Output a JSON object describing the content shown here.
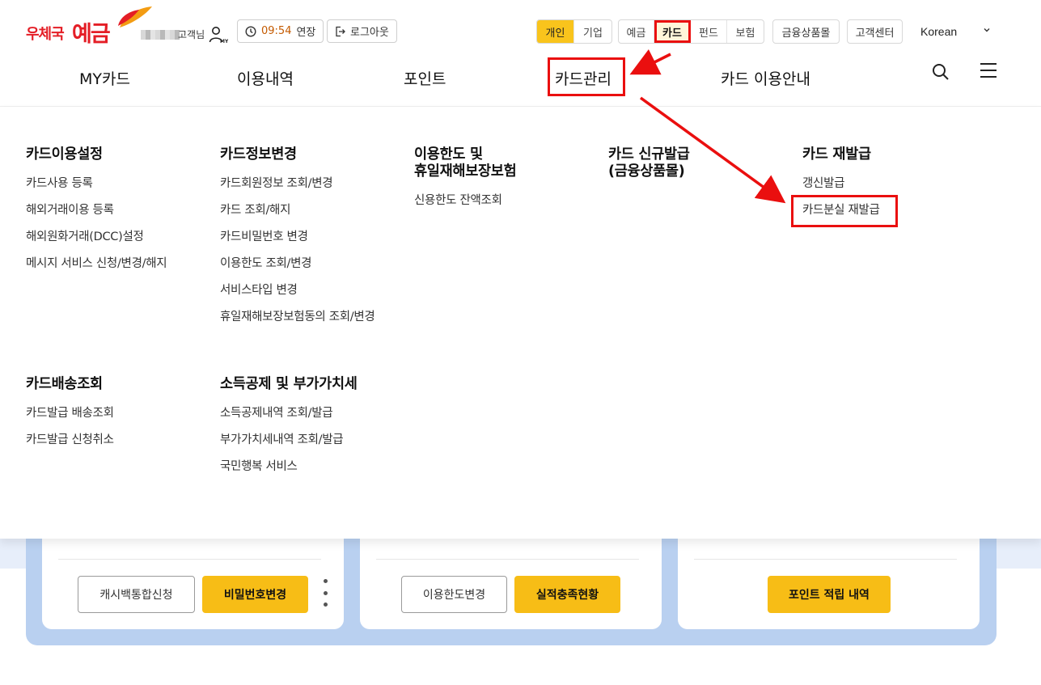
{
  "logo": {
    "brand": "우체국",
    "service": "예금"
  },
  "user": {
    "suffix": "고객님",
    "my_label": "MY"
  },
  "session": {
    "time": "09:54",
    "extend_label": "연장",
    "logout_label": "로그아웃"
  },
  "customer_type": {
    "options": [
      "개인",
      "기업"
    ],
    "active": "개인"
  },
  "service_tabs": {
    "options": [
      "예금",
      "카드",
      "펀드",
      "보험"
    ],
    "active": "카드"
  },
  "header_links": {
    "mall": "금융상품몰",
    "center": "고객센터"
  },
  "language": {
    "selected": "Korean"
  },
  "gnb": {
    "items": [
      "MY카드",
      "이용내역",
      "포인트",
      "카드관리",
      "카드 이용안내"
    ],
    "active": "카드관리"
  },
  "mega_menu": {
    "sections": [
      {
        "title": "카드이용설정",
        "items": [
          "카드사용 등록",
          "해외거래이용 등록",
          "해외원화거래(DCC)설정",
          "메시지 서비스 신청/변경/해지"
        ]
      },
      {
        "title": "카드정보변경",
        "items": [
          "카드회원정보 조회/변경",
          "카드 조회/해지",
          "카드비밀번호 변경",
          "이용한도 조회/변경",
          "서비스타입 변경",
          "휴일재해보장보험동의 조회/변경"
        ]
      },
      {
        "title_line1": "이용한도 및",
        "title_line2": "휴일재해보장보험",
        "items": [
          "신용한도 잔액조회"
        ]
      },
      {
        "title_line1": "카드 신규발급",
        "title_line2": "(금융상품몰)",
        "items": []
      },
      {
        "title": "카드 재발급",
        "items": [
          "갱신발급",
          "카드분실 재발급"
        ]
      },
      {
        "title": "카드배송조회",
        "items": [
          "카드발급 배송조회",
          "카드발급 신청취소"
        ]
      },
      {
        "title": "소득공제 및 부가가치세",
        "items": [
          "소득공제내역 조회/발급",
          "부가가치세내역 조회/발급",
          "국민행복 서비스"
        ]
      }
    ]
  },
  "background_cards": [
    {
      "buttons": [
        "캐시백통합신청",
        "비밀번호변경"
      ]
    },
    {
      "buttons": [
        "이용한도변경",
        "실적충족현황"
      ]
    },
    {
      "buttons": [
        "포인트 적립 내역"
      ]
    }
  ],
  "colors": {
    "accent": "#f9c41c",
    "brand_red": "#e41e26",
    "highlight_red": "#ea0f0f"
  }
}
